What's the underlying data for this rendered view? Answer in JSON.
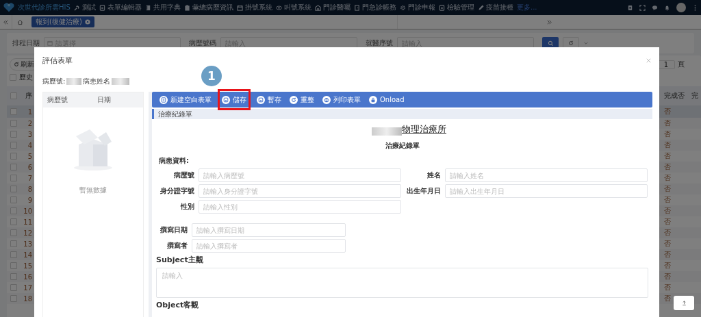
{
  "topbar": {
    "brand": "次世代診所雲HIS",
    "nav": [
      {
        "label": "測試"
      },
      {
        "label": "表單編輯器"
      },
      {
        "label": "共用字典"
      },
      {
        "label": "彙總病歷資訊"
      },
      {
        "label": "掛號系統"
      },
      {
        "label": "叫號系統"
      },
      {
        "label": "門診醫囑"
      },
      {
        "label": "門急診帳務"
      },
      {
        "label": "門診申報"
      },
      {
        "label": "檢驗管理"
      },
      {
        "label": "疫苗接種"
      }
    ],
    "more": "更多..."
  },
  "tabbar": {
    "tabs": [
      {
        "label": "報到(復健治療)",
        "selected": true
      }
    ]
  },
  "filters": [
    {
      "kind": "date",
      "label": "排程日期",
      "placeholder": "請選擇"
    },
    {
      "kind": "text",
      "label": "病歷號碼",
      "placeholder": "請輸入"
    },
    {
      "kind": "text",
      "label": "就醫序號",
      "placeholder": "請輸入"
    }
  ],
  "refresh_button": "刷新",
  "history_checkbox": {
    "label": "歷史",
    "checked": false
  },
  "pager": {
    "page": "1",
    "suffix": "頁"
  },
  "table": {
    "select_all_checked": false,
    "columns": [
      "序",
      "完成否",
      "完"
    ],
    "rows": [
      {
        "seq": "1",
        "done": "否",
        "checked": false,
        "selected": true
      },
      {
        "seq": "2",
        "done": "否",
        "checked": false,
        "selected": false
      },
      {
        "seq": "3",
        "done": "否",
        "checked": false,
        "selected": false
      },
      {
        "seq": "4",
        "done": "否",
        "checked": false,
        "selected": false
      },
      {
        "seq": "5",
        "done": "否",
        "checked": false,
        "selected": false
      },
      {
        "seq": "6",
        "done": "否",
        "checked": false,
        "selected": false
      },
      {
        "seq": "7",
        "done": "否",
        "checked": false,
        "selected": false
      },
      {
        "seq": "8",
        "done": "否",
        "checked": false,
        "selected": false
      },
      {
        "seq": "9",
        "done": "否",
        "checked": false,
        "selected": false
      },
      {
        "seq": "10",
        "done": "否",
        "checked": false,
        "selected": false
      },
      {
        "seq": "11",
        "done": "否",
        "checked": false,
        "selected": false
      },
      {
        "seq": "12",
        "done": "否",
        "checked": false,
        "selected": false
      },
      {
        "seq": "13",
        "done": "否",
        "checked": false,
        "selected": false
      },
      {
        "seq": "14",
        "done": "否",
        "checked": false,
        "selected": false
      },
      {
        "seq": "15",
        "done": "否",
        "checked": false,
        "selected": false
      },
      {
        "seq": "16",
        "done": "否",
        "checked": false,
        "selected": false
      },
      {
        "seq": "17",
        "done": "否",
        "checked": false,
        "selected": false
      },
      {
        "seq": "18",
        "done": "否",
        "checked": false,
        "selected": false
      }
    ]
  },
  "modal": {
    "title": "評估表單",
    "patient_labels": [
      "病歷號:",
      "病患姓名"
    ],
    "history_columns": [
      "病歷號",
      "日期"
    ],
    "empty_text": "暫無數據",
    "toolbar": [
      {
        "label": "新建空白表單",
        "highlighted": false
      },
      {
        "label": "儲存",
        "highlighted": true
      },
      {
        "label": "暫存",
        "highlighted": false
      },
      {
        "label": "重整",
        "highlighted": false
      },
      {
        "label": "列印表單",
        "highlighted": false
      },
      {
        "label": "Onload",
        "highlighted": false
      }
    ],
    "callout": "1",
    "section_title": "治療紀錄單",
    "form": {
      "clinic_suffix": "物理治療所",
      "subtitle": "治療紀錄單",
      "patient_heading": "病患資料:",
      "patient_fields": [
        {
          "label": "病歷號",
          "placeholder": "請輸入病歷號"
        },
        {
          "label": "姓名",
          "placeholder": "請輸入姓名"
        },
        {
          "label": "身分證字號",
          "placeholder": "請輸入身分證字號"
        },
        {
          "label": "出生年月日",
          "placeholder": "請輸入出生年月日"
        },
        {
          "label": "性別",
          "placeholder": "請輸入性別"
        }
      ],
      "author_fields": [
        {
          "label": "撰寫日期",
          "placeholder": "請輸入撰寫日期"
        },
        {
          "label": "撰寫者",
          "placeholder": "請輸入撰寫者"
        }
      ],
      "sections": [
        {
          "title": "Subject主觀",
          "placeholder": "請輸入"
        },
        {
          "title": "Object客觀"
        }
      ]
    }
  }
}
